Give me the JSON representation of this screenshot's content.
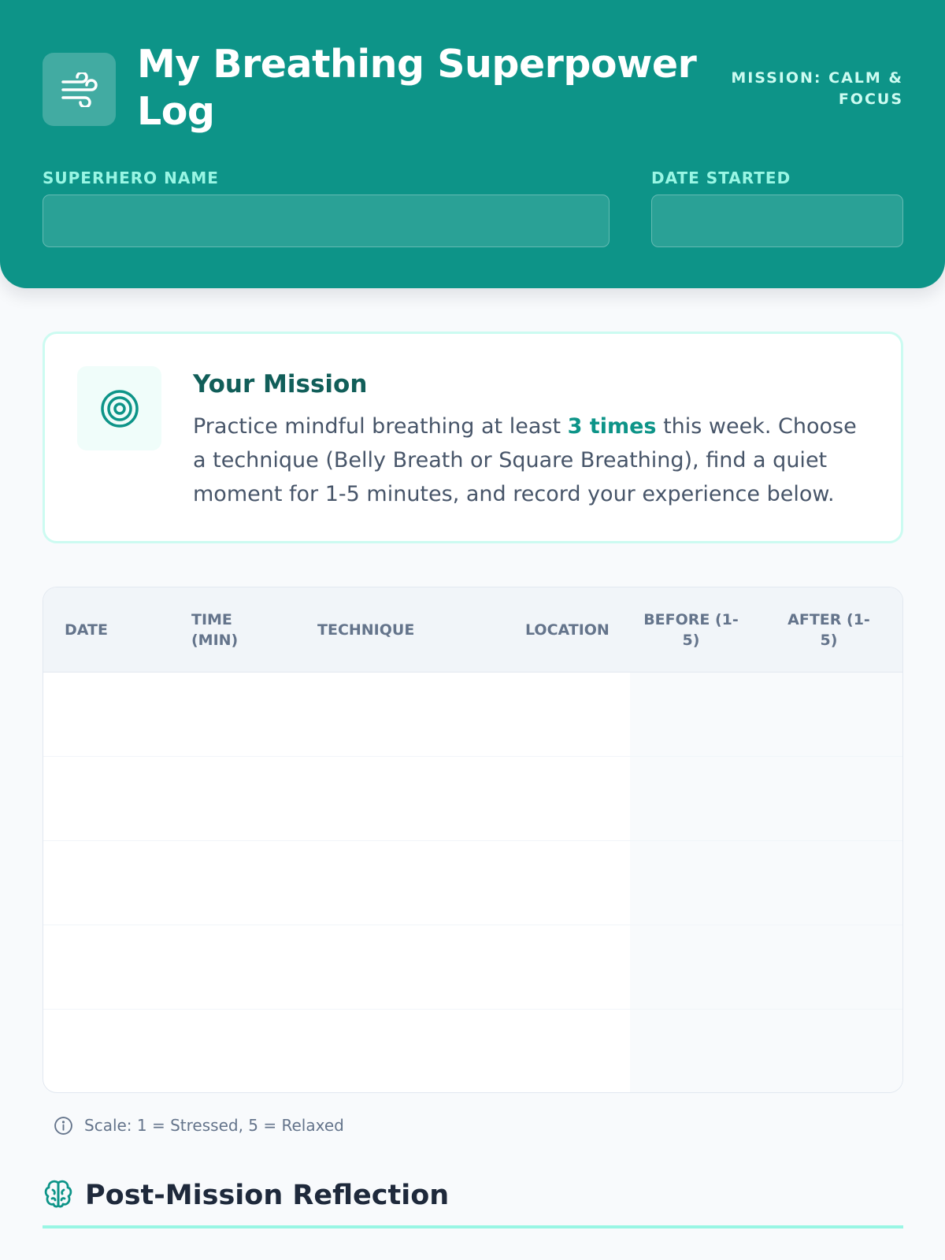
{
  "header": {
    "title": "My Breathing Superpower Log",
    "mission_tag": "MISSION: CALM & FOCUS",
    "fields": {
      "superhero_name_label": "SUPERHERO NAME",
      "superhero_name_value": "",
      "date_started_label": "DATE STARTED",
      "date_started_value": ""
    }
  },
  "mission": {
    "title": "Your Mission",
    "text_before": "Practice mindful breathing at least ",
    "highlight": "3 times",
    "text_after": " this week. Choose a technique (Belly Breath or Square Breathing), find a quiet moment for 1-5 minutes, and record your experience below."
  },
  "log_table": {
    "columns": [
      "DATE",
      "TIME (MIN)",
      "TECHNIQUE",
      "LOCATION",
      "BEFORE (1-5)",
      "AFTER (1-5)"
    ],
    "rows": [
      [
        "",
        "",
        "",
        "",
        "",
        ""
      ],
      [
        "",
        "",
        "",
        "",
        "",
        ""
      ],
      [
        "",
        "",
        "",
        "",
        "",
        ""
      ],
      [
        "",
        "",
        "",
        "",
        "",
        ""
      ],
      [
        "",
        "",
        "",
        "",
        "",
        ""
      ]
    ]
  },
  "scale_note": "Scale: 1 = Stressed, 5 = Relaxed",
  "reflection": {
    "title": "Post-Mission Reflection"
  },
  "colors": {
    "brand": "#0d9488",
    "brand_dark": "#115e59",
    "accent_light": "#99f6e4"
  },
  "icons": {
    "logo": "wind-icon",
    "mission": "target-icon",
    "note": "info-icon",
    "reflection": "brain-icon"
  }
}
